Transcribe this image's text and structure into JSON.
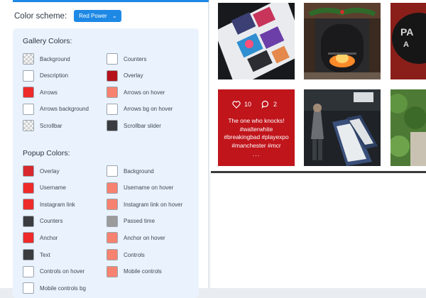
{
  "header": {
    "scheme_label": "Color scheme:",
    "scheme_value": "Red Power"
  },
  "sections": [
    {
      "title": "Gallery Colors:",
      "items": [
        {
          "label": "Background",
          "color": "checker"
        },
        {
          "label": "Counters",
          "color": "#ffffff"
        },
        {
          "label": "Description",
          "color": "#ffffff"
        },
        {
          "label": "Overlay",
          "color": "#b5121b"
        },
        {
          "label": "Arrows",
          "color": "#ee2a2a"
        },
        {
          "label": "Arrows on hover",
          "color": "#f7826f"
        },
        {
          "label": "Arrows background",
          "color": "#ffffff"
        },
        {
          "label": "Arrows bg on hover",
          "color": "#ffffff"
        },
        {
          "label": "Scrollbar",
          "color": "checker"
        },
        {
          "label": "Scrollbar slider",
          "color": "#3a3c3f"
        }
      ]
    },
    {
      "title": "Popup Colors:",
      "items": [
        {
          "label": "Overlay",
          "color": "#d8272d"
        },
        {
          "label": "Background",
          "color": "#ffffff"
        },
        {
          "label": "Username",
          "color": "#ee2a2a"
        },
        {
          "label": "Username on hover",
          "color": "#f7826f"
        },
        {
          "label": "Instagram link",
          "color": "#ee2a2a"
        },
        {
          "label": "Instagram link on hover",
          "color": "#f7826f"
        },
        {
          "label": "Counters",
          "color": "#3a3c3f"
        },
        {
          "label": "Passed time",
          "color": "#9b9b9b"
        },
        {
          "label": "Anchor",
          "color": "#ee2a2a"
        },
        {
          "label": "Anchor on hover",
          "color": "#f7826f"
        },
        {
          "label": "Text",
          "color": "#3a3c3f"
        },
        {
          "label": "Controls",
          "color": "#f7826f"
        },
        {
          "label": "Controls on hover",
          "color": "#ffffff"
        },
        {
          "label": "Mobile controls",
          "color": "#f7826f"
        },
        {
          "label": "Mobile controls bg",
          "color": "#ffffff"
        }
      ]
    }
  ],
  "gallery": {
    "post": {
      "likes": "10",
      "comments": "2",
      "caption": "The one who knocks! #walterwhite #breakingbad #playexpo #manchester #mcr",
      "more": "..."
    }
  }
}
